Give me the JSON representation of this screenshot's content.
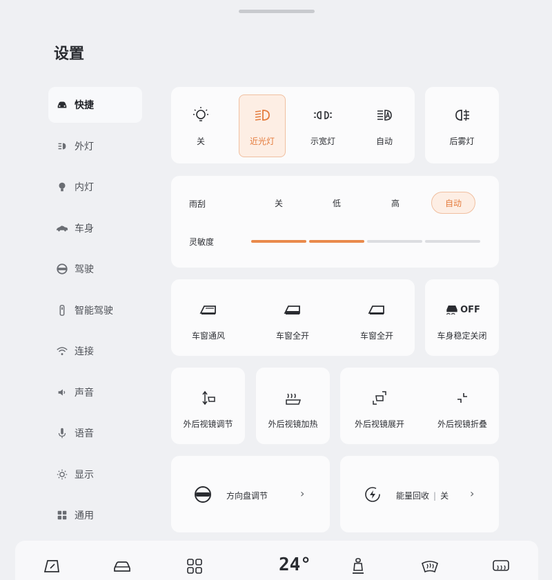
{
  "title": "设置",
  "sidebar": {
    "items": [
      {
        "label": "快捷",
        "icon": "car-icon",
        "active": true
      },
      {
        "label": "外灯",
        "icon": "headlight-icon"
      },
      {
        "label": "内灯",
        "icon": "bulb-icon"
      },
      {
        "label": "车身",
        "icon": "car-body-icon"
      },
      {
        "label": "驾驶",
        "icon": "steering-wheel-icon"
      },
      {
        "label": "智能驾驶",
        "icon": "smart-drive-icon"
      },
      {
        "label": "连接",
        "icon": "wifi-icon"
      },
      {
        "label": "声音",
        "icon": "speaker-icon"
      },
      {
        "label": "语音",
        "icon": "microphone-icon"
      },
      {
        "label": "显示",
        "icon": "brightness-icon"
      },
      {
        "label": "通用",
        "icon": "apps-grid-icon"
      }
    ]
  },
  "lights": {
    "options": [
      {
        "label": "关",
        "icon": "light-off-icon"
      },
      {
        "label": "近光灯",
        "icon": "low-beam-icon",
        "selected": true
      },
      {
        "label": "示宽灯",
        "icon": "parking-light-icon"
      },
      {
        "label": "自动",
        "icon": "auto-light-icon"
      }
    ],
    "rear_fog": {
      "label": "后雾灯",
      "icon": "rear-fog-icon"
    }
  },
  "wiper": {
    "label": "雨刮",
    "options": [
      "关",
      "低",
      "高",
      "自动"
    ],
    "selected": "自动",
    "sensitivity_label": "灵敏度",
    "sensitivity_level": 2,
    "sensitivity_max": 4
  },
  "windows": {
    "items": [
      {
        "label": "车窗通风",
        "icon": "window-vent-icon"
      },
      {
        "label": "车窗全开",
        "icon": "window-open-icon"
      },
      {
        "label": "车窗全开",
        "icon": "window-open-icon"
      }
    ],
    "esc": {
      "label": "车身稳定关闭",
      "icon": "esc-off-icon",
      "badge": "OFF"
    }
  },
  "mirrors": {
    "items": [
      {
        "label": "外后视镜调节",
        "icon": "mirror-adjust-icon"
      },
      {
        "label": "外后视镜加热",
        "icon": "mirror-heat-icon"
      },
      {
        "label": "外后视镜展开",
        "icon": "mirror-unfold-icon"
      },
      {
        "label": "外后视镜折叠",
        "icon": "mirror-fold-icon"
      }
    ]
  },
  "links": {
    "steering": {
      "label": "方向盘调节",
      "icon": "steering-wheel-icon"
    },
    "energy": {
      "label": "能量回收",
      "value": "关",
      "separator": "|",
      "icon": "energy-recovery-icon"
    }
  },
  "dock": {
    "temperature": "24°",
    "items": [
      "navigation-icon",
      "car-icon",
      "apps-icon",
      "seat-icon",
      "front-defrost-icon",
      "rear-defrost-icon"
    ]
  },
  "colors": {
    "accent": "#e98a4c",
    "accent_bg": "#fdeee4",
    "background": "#eff0f3",
    "card": "#fbfbfc"
  }
}
